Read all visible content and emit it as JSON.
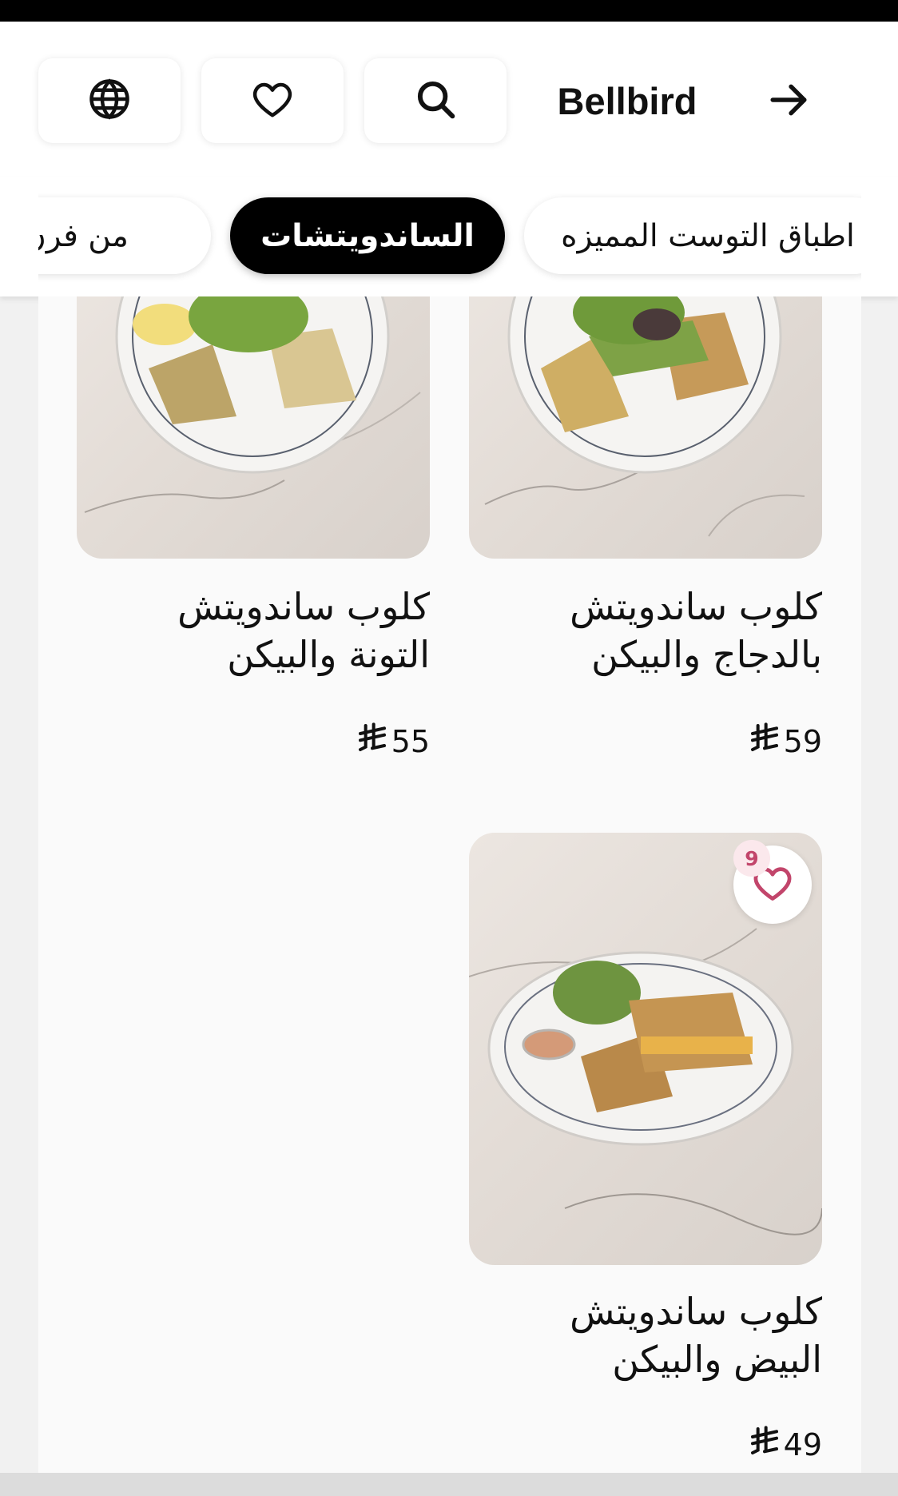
{
  "header": {
    "brand": "Bellbird",
    "icons": {
      "back": "arrow-right-icon",
      "search": "search-icon",
      "favorites": "heart-icon",
      "language": "globe-icon"
    }
  },
  "tabs": [
    {
      "label": "اطباق التوست المميزه",
      "active": false
    },
    {
      "label": "الساندويتشات",
      "active": true
    },
    {
      "label": "من فرن الم",
      "active": false
    }
  ],
  "products": [
    {
      "name_line1": "كلوب ساندويتش",
      "name_line2": "بالدجاج والبيكن",
      "price": "59",
      "currency": "riyal-symbol"
    },
    {
      "name_line1": "كلوب ساندويتش",
      "name_line2": "التونة والبيكن",
      "price": "55",
      "currency": "riyal-symbol"
    },
    {
      "name_line1": "كلوب ساندويتش",
      "name_line2": "البيض والبيكن",
      "price": "49",
      "currency": "riyal-symbol",
      "favorites_count": "9"
    }
  ],
  "colors": {
    "accent_active_tab": "#000000",
    "favorite_pink": "#c2456b",
    "background": "#fafafa"
  }
}
